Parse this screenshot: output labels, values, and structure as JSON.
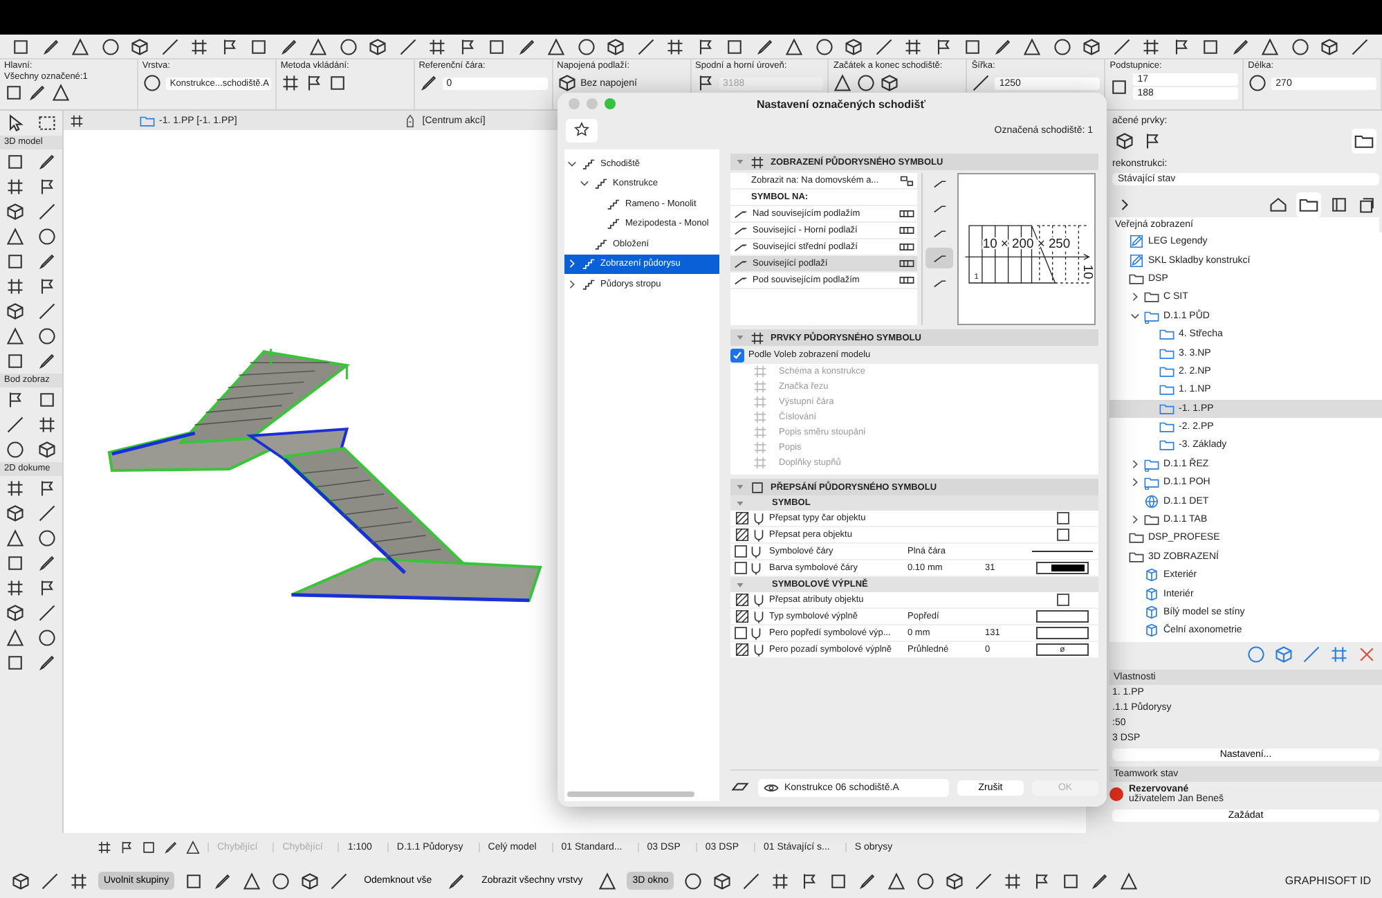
{
  "info_box": {
    "groups": [
      {
        "label": "Hlavní:",
        "sublabel": "Všechny označené:1"
      },
      {
        "label": "Vrstva:",
        "fields": [
          {
            "kind": "dropdown",
            "text": "Konstrukce...schodiště.A"
          }
        ]
      },
      {
        "label": "Metoda vkládání:"
      },
      {
        "label": "Referenční čára:",
        "fields": [
          {
            "kind": "field",
            "text": "0"
          }
        ]
      },
      {
        "label": "Napojená podlaží:",
        "fields": [
          {
            "kind": "plain",
            "text": "Bez napojení"
          }
        ]
      },
      {
        "label": "Spodní a horní úroveň:",
        "fields": [
          {
            "kind": "greyed",
            "text": "3188"
          }
        ]
      },
      {
        "label": "Začátek a konec schodiště:"
      },
      {
        "label": "Šířka:",
        "fields": [
          {
            "kind": "field",
            "text": "1250"
          }
        ]
      },
      {
        "label": "Podstupnice:",
        "fields": [
          {
            "kind": "field",
            "text": "17"
          },
          {
            "kind": "field",
            "text": "188"
          }
        ]
      },
      {
        "label": "Délka:",
        "fields": [
          {
            "kind": "field",
            "text": "270"
          }
        ]
      }
    ]
  },
  "tabs": [
    {
      "label": "-1. 1.PP [-1. 1.PP]",
      "kind": "floorplan"
    },
    {
      "label": "[Centrum akcí]",
      "kind": "actions"
    }
  ],
  "toolbox": {
    "sections": [
      {
        "title": "3D model"
      },
      {
        "title": "Bod zobraz"
      },
      {
        "title": "2D dokume"
      }
    ]
  },
  "dialog": {
    "title": "Nastavení označených schodišť",
    "selection_count": "Označená schodiště: 1",
    "tree": [
      {
        "label": "Schodiště",
        "expanded": true,
        "selected": false,
        "children": [
          {
            "label": "Konstrukce",
            "expanded": true,
            "selected": false,
            "children": [
              {
                "label": "Rameno - Monolit",
                "selected": false
              },
              {
                "label": "Mezipodesta - Monol",
                "selected": false
              }
            ]
          },
          {
            "label": "Obložení",
            "selected": false
          }
        ]
      },
      {
        "label": "Zobrazení půdorysu",
        "expanded": false,
        "selected": true
      },
      {
        "label": "Půdorys stropu",
        "expanded": false,
        "selected": false
      }
    ],
    "symbol_section": {
      "title": "ZOBRAZENÍ PŮDORYSNÉHO SYMBOLU",
      "show_on": "Zobrazit na: Na domovském a...",
      "symbol_header": "SYMBOL NA:",
      "options": [
        {
          "label": "Nad souvisejícím podlažím",
          "selected": false
        },
        {
          "label": "Související - Horní podlaží",
          "selected": false
        },
        {
          "label": "Související střední podlaží",
          "selected": false
        },
        {
          "label": "Související podlaží",
          "selected": true
        },
        {
          "label": "Pod souvisejícím podlažím",
          "selected": false
        }
      ],
      "preview": {
        "dimension": "10 × 200 × 250",
        "riser_count": "10",
        "step_number": "1"
      }
    },
    "elements_section": {
      "title": "PRVKY PŮDORYSNÉHO SYMBOLU",
      "by_model_view": {
        "label": "Podle Voleb zobrazení modelu",
        "checked": true
      },
      "items": [
        {
          "label": "Schéma a konstrukce",
          "disabled": true
        },
        {
          "label": "Značka řezu",
          "disabled": true
        },
        {
          "label": "Výstupní čára",
          "disabled": true
        },
        {
          "label": "Číslování",
          "disabled": true
        },
        {
          "label": "Popis směru stoupání",
          "disabled": true
        },
        {
          "label": "Popis",
          "disabled": true
        },
        {
          "label": "Doplňky stupňů",
          "disabled": true
        }
      ]
    },
    "override_section": {
      "title": "PŘEPSÁNÍ PŮDORYSNÉHO SYMBOLU",
      "groups": [
        {
          "title": "SYMBOL",
          "rows": [
            {
              "kind": "checkbox",
              "label": "Přepsat typy čar objektu",
              "checked": false
            },
            {
              "kind": "checkbox",
              "label": "Přepsat pera objektu",
              "checked": false
            },
            {
              "kind": "line",
              "label": "Symbolové čáry",
              "value": "Plná čára",
              "checked": false
            },
            {
              "kind": "pen",
              "label": "Barva symbolové čáry",
              "value": "0.10 mm",
              "number": "31",
              "checked": false
            }
          ]
        },
        {
          "title": "SYMBOLOVÉ VÝPLNĚ",
          "rows": [
            {
              "kind": "checkbox",
              "label": "Přepsat atributy objektu",
              "checked": false
            },
            {
              "kind": "fill",
              "label": "Typ symbolové výplně",
              "value": "Popředí"
            },
            {
              "kind": "swatch",
              "label": "Pero popředí symbolové výp...",
              "value": "0 mm",
              "number": "131",
              "checked": false
            },
            {
              "kind": "swatch",
              "label": "Pero pozadí symbolové výplně",
              "value": "Průhledné",
              "number": "0",
              "swatch_text": "ø"
            }
          ]
        }
      ]
    },
    "footer": {
      "layer": "Konstrukce 06 schodiště.A",
      "cancel": "Zrušit",
      "ok": {
        "label": "OK",
        "disabled": true
      }
    }
  },
  "right_panel": {
    "selected_elements_label": "ačené prvky:",
    "renovation_label": "rekonstrukci:",
    "renovation_value": "Stávající stav",
    "view_set": "Veřejná zobrazení",
    "view_tree": [
      {
        "label": "LEG Legendy",
        "kind": "detail"
      },
      {
        "label": "SKL Skladby konstrukcí",
        "kind": "detail"
      },
      {
        "label": "DSP",
        "kind": "folder",
        "children": [
          {
            "label": "C SIT",
            "kind": "folder",
            "expanded": false
          },
          {
            "label": "D.1.1 PŮD",
            "kind": "clone",
            "expanded": true,
            "children": [
              {
                "label": "4. Střecha",
                "kind": "story",
                "selected": false
              },
              {
                "label": "3. 3.NP",
                "kind": "story",
                "selected": false
              },
              {
                "label": "2. 2.NP",
                "kind": "story",
                "selected": false
              },
              {
                "label": "1. 1.NP",
                "kind": "story",
                "selected": false
              },
              {
                "label": "-1. 1.PP",
                "kind": "story",
                "selected": true
              },
              {
                "label": "-2. 2.PP",
                "kind": "story",
                "selected": false
              },
              {
                "label": "-3. Základy",
                "kind": "story",
                "selected": false
              }
            ]
          },
          {
            "label": "D.1.1 ŘEZ",
            "kind": "clone",
            "expanded": false
          },
          {
            "label": "D.1.1 POH",
            "kind": "clone",
            "expanded": false
          },
          {
            "label": "D.1.1 DET",
            "kind": "globe"
          },
          {
            "label": "D.1.1 TAB",
            "kind": "folder",
            "expanded": false
          }
        ]
      },
      {
        "label": "DSP_PROFESE",
        "kind": "folder"
      },
      {
        "label": "3D ZOBRAZENÍ",
        "kind": "folder",
        "children": [
          {
            "label": "Exteriér",
            "kind": "perspective"
          },
          {
            "label": "Interiér",
            "kind": "perspective"
          },
          {
            "label": "Bílý model se stíny",
            "kind": "perspective"
          },
          {
            "label": "Čelní axonometrie",
            "kind": "perspective"
          }
        ]
      }
    ],
    "properties": {
      "title": "Vlastnosti",
      "rows": [
        "1. 1.PP",
        ".1.1 Půdorysy",
        ":50",
        "3 DSP"
      ]
    },
    "settings_button": "Nastavení...",
    "teamwork": {
      "title": "Teamwork stav",
      "status": "Rezervované",
      "user": "uživatelem Jan Beneš",
      "request_button": "Zažádat"
    }
  },
  "status_bar": {
    "items": [
      {
        "text": "Chybějící",
        "disabled": true
      },
      {
        "text": "Chybějící",
        "disabled": true
      },
      {
        "text": "1:100",
        "disabled": false
      },
      {
        "text": "D.1.1 Půdorysy",
        "disabled": false
      },
      {
        "text": "Celý model",
        "disabled": false
      },
      {
        "text": "01 Standard...",
        "disabled": false
      },
      {
        "text": "03 DSP",
        "disabled": false
      },
      {
        "text": "03 DSP",
        "disabled": false
      },
      {
        "text": "01 Stávající s...",
        "disabled": false
      },
      {
        "text": "S obrysy",
        "disabled": false
      }
    ]
  },
  "bottom_toolbar": {
    "buttons": [
      {
        "label": "Uvolnit skupiny",
        "selected": true
      },
      {
        "label": "Odemknout vše",
        "selected": false
      },
      {
        "label": "Zobrazit všechny vrstvy",
        "selected": false
      },
      {
        "label": "3D okno",
        "selected": true
      }
    ],
    "brand": "GRAPHISOFT ID"
  }
}
